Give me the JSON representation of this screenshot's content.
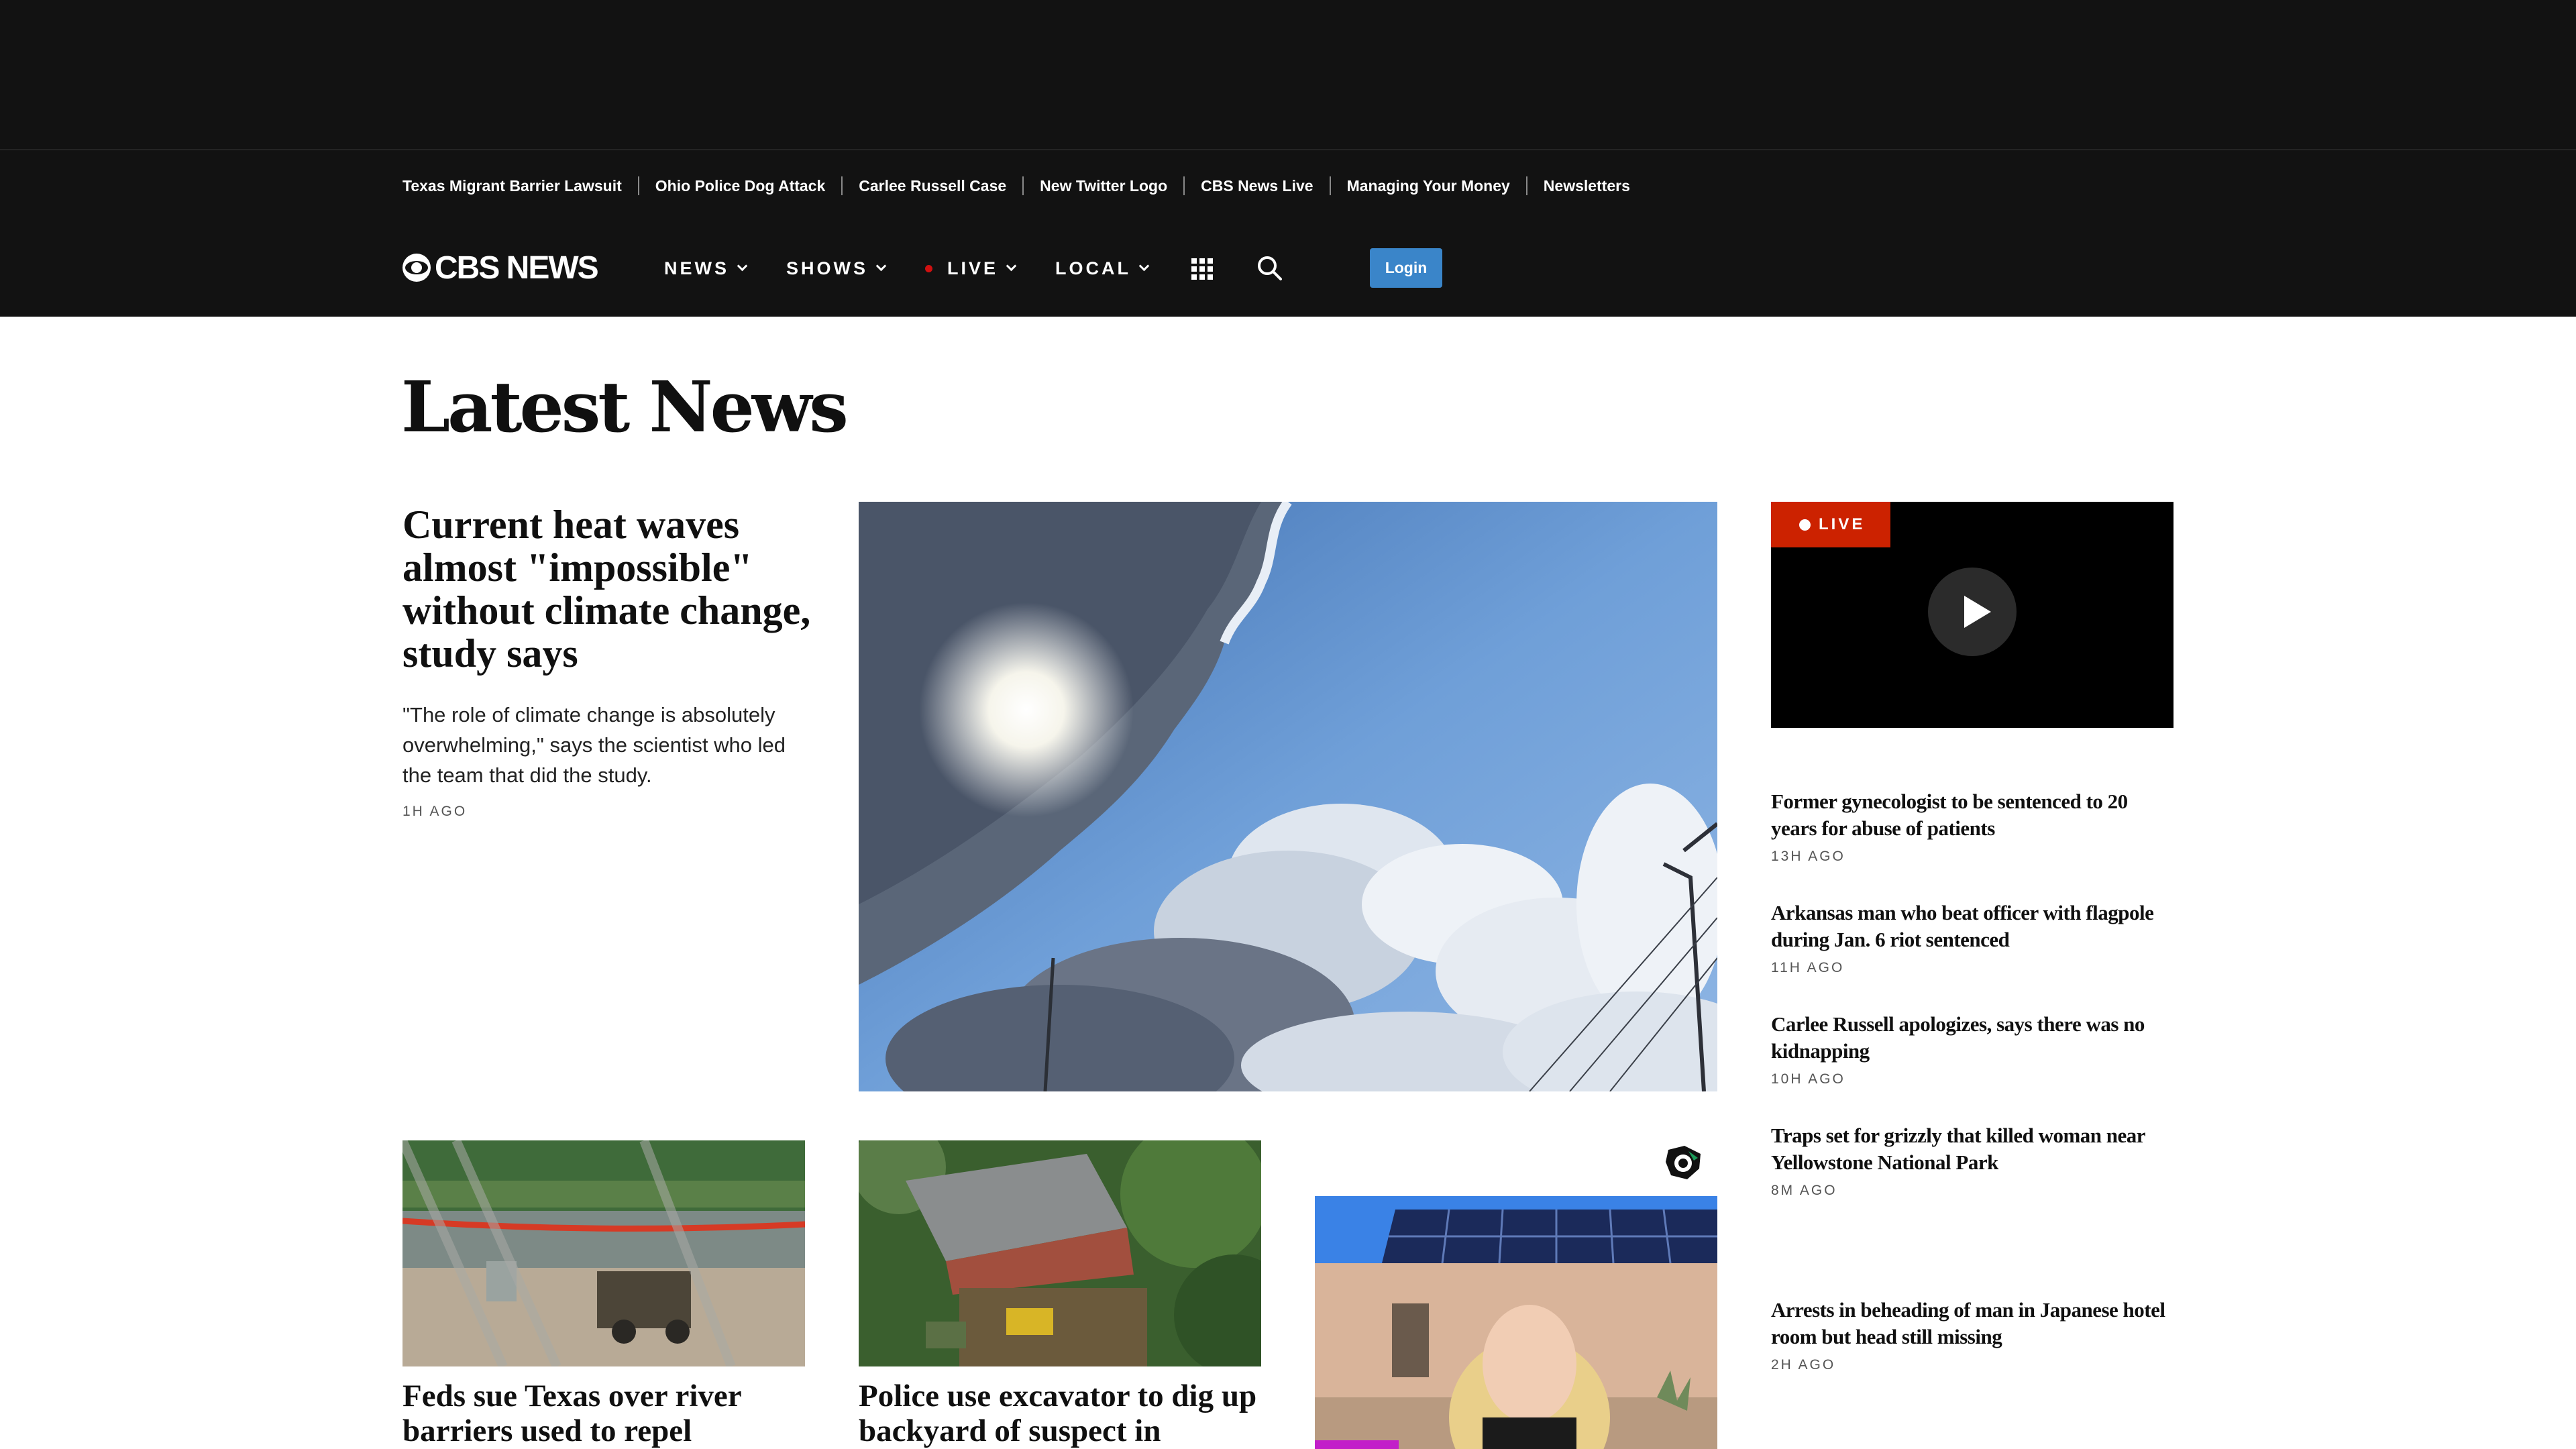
{
  "trending": {
    "items": [
      "Texas Migrant Barrier Lawsuit",
      "Ohio Police Dog Attack",
      "Carlee Russell Case",
      "New Twitter Logo",
      "CBS News Live",
      "Managing Your Money",
      "Newsletters"
    ]
  },
  "header": {
    "logo_text": "CBS NEWS",
    "nav": [
      {
        "label": "NEWS"
      },
      {
        "label": "SHOWS"
      },
      {
        "label": "LIVE"
      },
      {
        "label": "LOCAL"
      }
    ],
    "login_label": "Login"
  },
  "main": {
    "page_title": "Latest News",
    "lead": {
      "headline": "Current heat waves almost \"impossible\" without climate change, study says",
      "dek": "\"The role of climate change is absolutely overwhelming,\" says the scientist who led the team that did the study.",
      "time": "1H AGO"
    },
    "live_badge": "LIVE",
    "sidebar": [
      {
        "headline": "Former gynecologist to be sentenced to 20 years for abuse of patients",
        "time": "13H AGO"
      },
      {
        "headline": "Arkansas man who beat officer with flagpole during Jan. 6 riot sentenced",
        "time": "11H AGO"
      },
      {
        "headline": "Carlee Russell apologizes, says there was no kidnapping",
        "time": "10H AGO"
      },
      {
        "headline": "Traps set for grizzly that killed woman near Yellowstone National Park",
        "time": "8M AGO"
      },
      {
        "headline": "Arrests in beheading of man in Japanese hotel room but head still missing",
        "time": "2H AGO"
      }
    ],
    "cards": [
      {
        "headline": "Feds sue Texas over river barriers used to repel"
      },
      {
        "headline": "Police use excavator to dig up backyard of suspect in"
      }
    ]
  },
  "colors": {
    "header_bg": "#121212",
    "login_button": "#3a85c9",
    "live_red": "#cc2200",
    "ad_accent": "#c21fc9"
  },
  "icons": [
    "cbs-eye-logo-icon",
    "chevron-down-icon",
    "live-dot-icon",
    "apps-grid-icon",
    "search-icon",
    "play-icon",
    "ad-choices-icon"
  ]
}
